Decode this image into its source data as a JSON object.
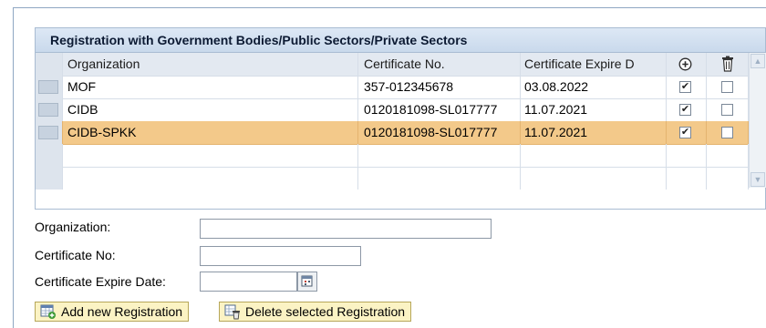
{
  "panel": {
    "title": "Registration with Government Bodies/Public Sectors/Private Sectors"
  },
  "table": {
    "headers": {
      "organization": "Organization",
      "certificate_no": "Certificate No.",
      "certificate_expire": "Certificate Expire D",
      "add_icon": "plus-circle-icon",
      "delete_icon": "trash-icon"
    },
    "rows": [
      {
        "organization": "MOF",
        "certificate_no": "357-012345678",
        "expire": "03.08.2022",
        "active": true,
        "delete": false,
        "selected": false
      },
      {
        "organization": "CIDB",
        "certificate_no": "0120181098-SL017777",
        "expire": "11.07.2021",
        "active": true,
        "delete": false,
        "selected": false
      },
      {
        "organization": "CIDB-SPKK",
        "certificate_no": "0120181098-SL017777",
        "expire": "11.07.2021",
        "active": true,
        "delete": false,
        "selected": true
      }
    ]
  },
  "form": {
    "organization_label": "Organization:",
    "organization_value": "",
    "certificate_no_label": "Certificate No:",
    "certificate_no_value": "",
    "expire_label": "Certificate Expire Date:",
    "expire_value": ""
  },
  "buttons": {
    "add_label": "Add new Registration",
    "delete_label": "Delete selected Registration"
  },
  "colors": {
    "selected_row": "#f3c98a",
    "header_bg": "#e3e9f1",
    "button_bg": "#fbf3c4"
  }
}
